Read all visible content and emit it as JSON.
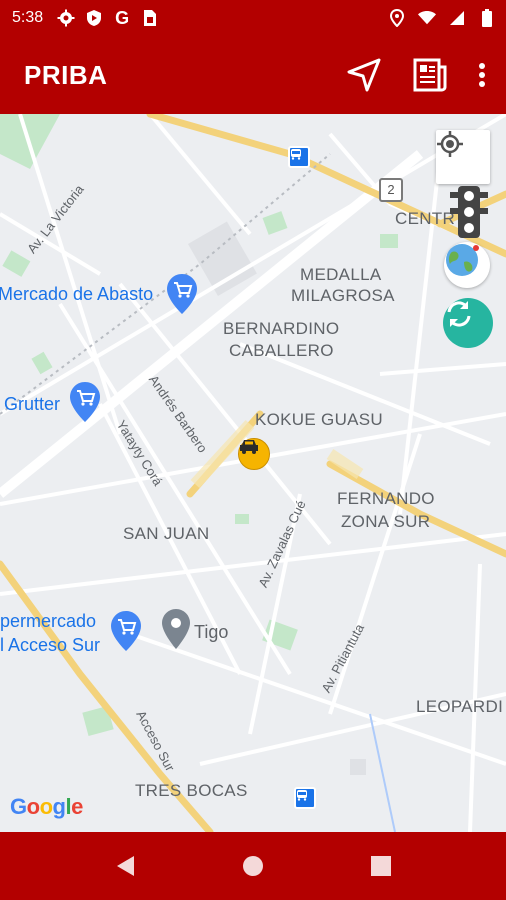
{
  "status_bar": {
    "time": "5:38",
    "left_icons": [
      "gear-icon",
      "shield-icon",
      "g-icon",
      "sim-card-icon"
    ],
    "right_icons": [
      "location-icon",
      "wifi-icon",
      "signal-icon",
      "battery-icon"
    ]
  },
  "app_bar": {
    "title": "PRIBA",
    "actions": [
      "navigation-arrow-icon",
      "news-icon",
      "more-vert-icon"
    ]
  },
  "map": {
    "neighborhoods": {
      "centro": "CENTR",
      "medalla_1": "MEDALLA",
      "medalla_2": "MILAGROSA",
      "bernardino_1": "BERNARDINO",
      "bernardino_2": "CABALLERO",
      "kokue": "KOKUE GUASU",
      "fernando_1": "FERNANDO",
      "fernando_2": "ZONA SUR",
      "san_juan": "SAN JUAN",
      "leopardi": "LEOPARDI",
      "tres_bocas": "TRES BOCAS"
    },
    "pois": {
      "abasto": "Mercado de Abasto",
      "gutter": "Grutter",
      "super_1": "permercado",
      "super_2": "l Acceso Sur",
      "tigo": "Tigo"
    },
    "streets": {
      "victoria": "Av. La Victoria",
      "barbero": "Andrés Barbero",
      "yatayty": "Yatayty Corá",
      "zavalas": "Av. Zavalas Cué",
      "pitiantuta": "Av. Pitiantuta",
      "acceso": "Acceso Sur"
    },
    "route_shield": "2",
    "attribution": "Google"
  },
  "colors": {
    "brand": "#b30000",
    "teal": "#26b5a0",
    "road_yellow": "#f3d27b",
    "park_green": "#c4e7c9",
    "poi_blue": "#1a73e8"
  }
}
